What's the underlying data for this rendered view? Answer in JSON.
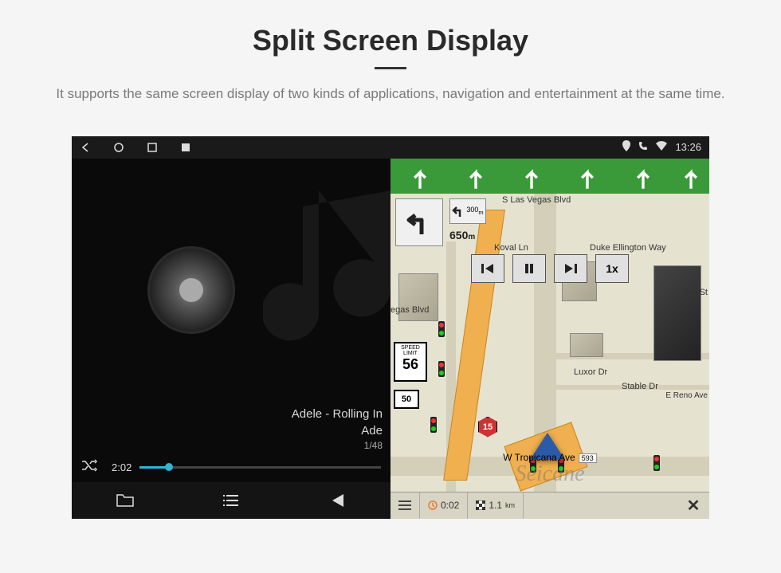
{
  "header": {
    "title": "Split Screen Display",
    "subtitle": "It supports the same screen display of two kinds of applications, navigation and entertainment at the same time."
  },
  "statusbar": {
    "time": "13:26"
  },
  "music": {
    "track_title": "Adele - Rolling In",
    "artist": "Ade",
    "counter": "1/48",
    "elapsed": "2:02"
  },
  "nav": {
    "top_street": "S Las Vegas Blvd",
    "turn_dist_next": "300",
    "turn_dist_next_unit": "m",
    "turn_dist_main": "650",
    "turn_dist_main_unit": "m",
    "speed_label": "SPEED LIMIT",
    "speed_value": "56",
    "route_number": "50",
    "interstate": "15",
    "play_speed": "1x",
    "street_koval": "Koval Ln",
    "street_duke": "Duke Ellington Way",
    "street_luxor": "Luxor Dr",
    "street_stable": "Stable Dr",
    "street_reno": "E Reno Ave",
    "street_vegas": "egas Blvd",
    "street_ales": "iles St",
    "bottom_street": "W Tropicana Ave",
    "bottom_addr": "593",
    "eta_time": "0:02",
    "eta_dist": "1.1",
    "eta_dist_unit": "km"
  },
  "watermark": "Seicane"
}
